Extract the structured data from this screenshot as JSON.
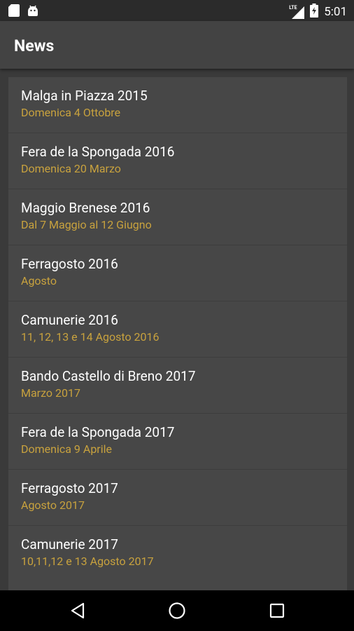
{
  "status_bar": {
    "time": "5:01",
    "network_label": "LTE",
    "left_icons": [
      "sd-card-icon",
      "android-icon"
    ],
    "right_icons": [
      "lte-signal-icon",
      "battery-charging-icon"
    ]
  },
  "app_bar": {
    "title": "News"
  },
  "news": [
    {
      "title": "Malga in Piazza 2015",
      "subtitle": "Domenica 4 Ottobre"
    },
    {
      "title": "Fera de la Spongada 2016",
      "subtitle": "Domenica 20 Marzo"
    },
    {
      "title": "Maggio Brenese 2016",
      "subtitle": "Dal 7 Maggio al 12 Giugno"
    },
    {
      "title": "Ferragosto 2016",
      "subtitle": "Agosto"
    },
    {
      "title": "Camunerie 2016",
      "subtitle": "11, 12, 13 e 14 Agosto 2016"
    },
    {
      "title": "Bando Castello di Breno 2017",
      "subtitle": "Marzo 2017"
    },
    {
      "title": "Fera de la Spongada 2017",
      "subtitle": "Domenica 9 Aprile"
    },
    {
      "title": "Ferragosto 2017",
      "subtitle": "Agosto 2017"
    },
    {
      "title": "Camunerie 2017",
      "subtitle": "10,11,12 e 13 Agosto 2017"
    }
  ],
  "nav_bar": {
    "icons": [
      "back-icon",
      "home-icon",
      "recents-icon"
    ]
  },
  "colors": {
    "status_bar": "#2b2b2b",
    "app_bar": "#434343",
    "background": "#3a3a3a",
    "card": "#474747",
    "title_text": "#ffffff",
    "subtitle_text": "#c8a23e",
    "nav_bar": "#000000"
  }
}
